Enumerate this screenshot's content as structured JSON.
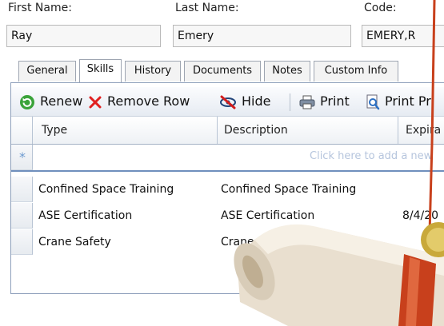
{
  "form": {
    "first_name_label": "First Name:",
    "first_name_value": "Ray",
    "last_name_label": "Last Name:",
    "last_name_value": "Emery",
    "code_label": "Code:",
    "code_value": "EMERY,R"
  },
  "tabs": [
    {
      "label": "General"
    },
    {
      "label": "Skills"
    },
    {
      "label": "History"
    },
    {
      "label": "Documents"
    },
    {
      "label": "Notes"
    },
    {
      "label": "Custom Info"
    }
  ],
  "toolbar": {
    "renew_label": "Renew",
    "remove_row_label": "Remove Row",
    "hide_label": "Hide",
    "print_label": "Print",
    "print_preview_label": "Print Pr"
  },
  "grid": {
    "columns": [
      "Type",
      "Description",
      "Expira"
    ],
    "new_row_symbol": "*",
    "new_row_hint": "Click here to add a new",
    "rows": [
      {
        "type": "Confined Space Training",
        "description": "Confined Space Training",
        "expiration": ""
      },
      {
        "type": "ASE Certification",
        "description": "ASE Certification",
        "expiration": "8/4/20"
      },
      {
        "type": "Crane Safety",
        "description": "Crane Safety",
        "expiration": ""
      }
    ]
  },
  "colors": {
    "panel_border": "#8ea0bb",
    "renew_icon": "#3aa33a",
    "remove_icon": "#e02020",
    "scroll_paper": "#efe6d6",
    "ribbon": "#c8401c",
    "seal": "#c9a93a"
  },
  "icons": {
    "renew": "renew-icon",
    "remove": "remove-x-icon",
    "hide": "hide-icon",
    "print": "printer-icon",
    "print_preview": "print-preview-icon",
    "add_row": "asterisk-icon"
  }
}
